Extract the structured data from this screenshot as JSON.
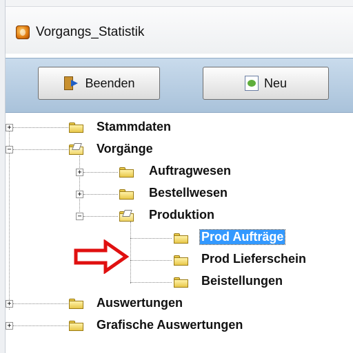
{
  "window": {
    "title": "Vorgangs_Statistik",
    "icon": "app-orange-icon"
  },
  "toolbar": {
    "exit_label": "Beenden",
    "exit_icon": "exit-door-icon",
    "new_label": "Neu",
    "new_icon": "new-document-icon"
  },
  "tree": {
    "stammdaten": "Stammdaten",
    "vorgaenge": "Vorgänge",
    "auftragwesen": "Auftragwesen",
    "bestellwesen": "Bestellwesen",
    "produktion": "Produktion",
    "prod_auftraege": "Prod Aufträge",
    "prod_lieferschein": "Prod Lieferschein",
    "beistellungen": "Beistellungen",
    "auswertungen": "Auswertungen",
    "grafische_auswertungen": "Grafische Auswertungen",
    "selected": "Prod Aufträge"
  },
  "annotation": {
    "icon": "red-arrow-icon",
    "color": "#e01010"
  },
  "colors": {
    "toolbar": "#b6cde3",
    "selection": "#3399ff"
  }
}
